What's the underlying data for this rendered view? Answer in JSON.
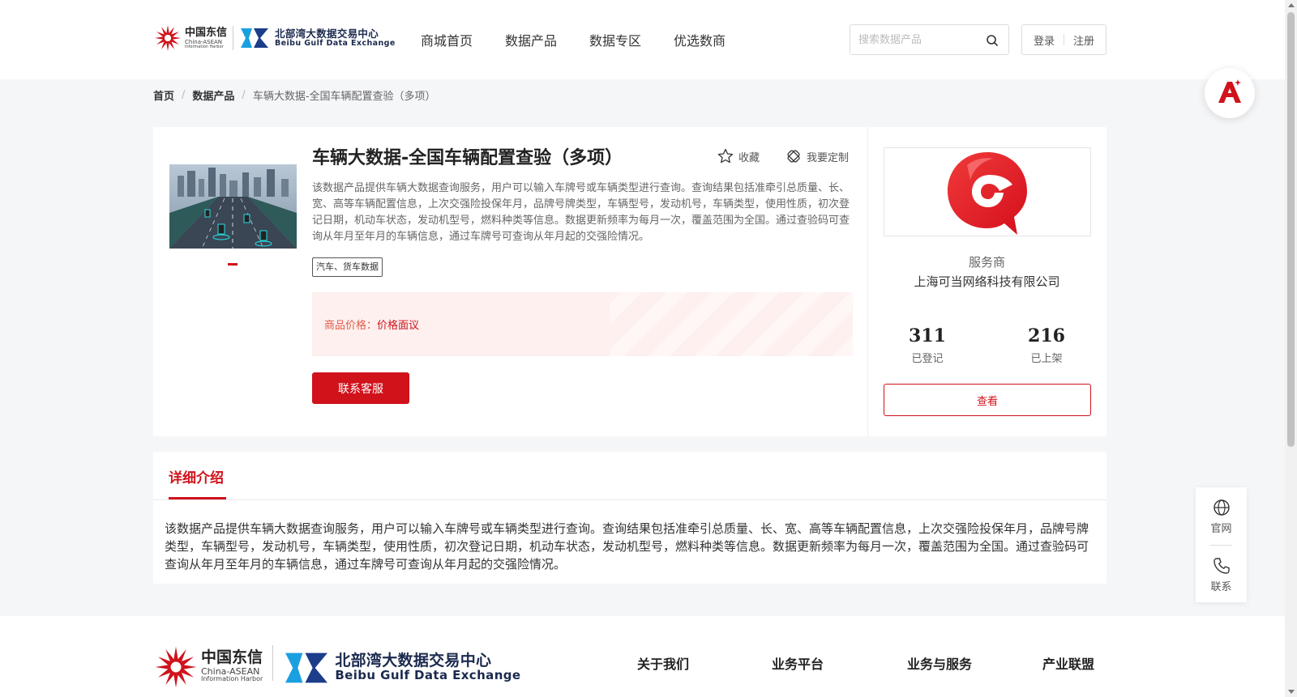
{
  "header": {
    "logo_cn_line1": "中国东信",
    "logo_cn_line2": "China-ASEAN",
    "logo_cn_line3": "Information Harbor",
    "logo_bx_line1": "北部湾大数据交易中心",
    "logo_bx_line2": "Beibu Gulf Data Exchange",
    "nav": [
      "商城首页",
      "数据产品",
      "数据专区",
      "优选数商"
    ],
    "search_placeholder": "搜索数据产品",
    "login": "登录",
    "register": "注册"
  },
  "breadcrumb": [
    "首页",
    "数据产品",
    "车辆大数据-全国车辆配置查验（多项）"
  ],
  "product": {
    "title": "车辆大数据-全国车辆配置查验（多项）",
    "favorite": "收藏",
    "customize": "我要定制",
    "description": "该数据产品提供车辆大数据查询服务，用户可以输入车牌号或车辆类型进行查询。查询结果包括准牵引总质量、长、宽、高等车辆配置信息，上次交强险投保年月，品牌号牌类型，车辆型号，发动机号，车辆类型，使用性质，初次登记日期，机动车状态，发动机型号，燃料种类等信息。数据更新频率为每月一次，覆盖范围为全国。通过查验码可查询从年月至年月的车辆信息，通过车牌号可查询从年月起的交强险情况。",
    "tag": "汽车、货车数据",
    "price_label": "商品价格：",
    "price_value": "价格面议",
    "contact_button": "联系客服"
  },
  "provider": {
    "label": "服务商",
    "name": "上海可当网络科技有限公司",
    "registered_count": "311",
    "registered_label": "已登记",
    "listed_count": "216",
    "listed_label": "已上架",
    "view_button": "查看"
  },
  "detail": {
    "tab": "详细介绍",
    "text": "该数据产品提供车辆大数据查询服务，用户可以输入车牌号或车辆类型进行查询。查询结果包括准牵引总质量、长、宽、高等车辆配置信息，上次交强险投保年月，品牌号牌类型，车辆型号，发动机号，车辆类型，使用性质，初次登记日期，机动车状态，发动机型号，燃料种类等信息。数据更新频率为每月一次，覆盖范围为全国。通过查验码可查询从年月至年月的车辆信息，通过车牌号可查询从年月起的交强险情况。"
  },
  "side_float": {
    "website": "官网",
    "contact": "联系"
  },
  "footer": {
    "nav": [
      "关于我们",
      "业务平台",
      "业务与服务",
      "产业联盟"
    ]
  },
  "colors": {
    "brand_red": "#d0121b",
    "price_bg": "#fdf0ee"
  },
  "icons": [
    "search-icon",
    "star-icon",
    "customize-icon",
    "globe-icon",
    "phone-icon",
    "ai-assistant-icon"
  ]
}
